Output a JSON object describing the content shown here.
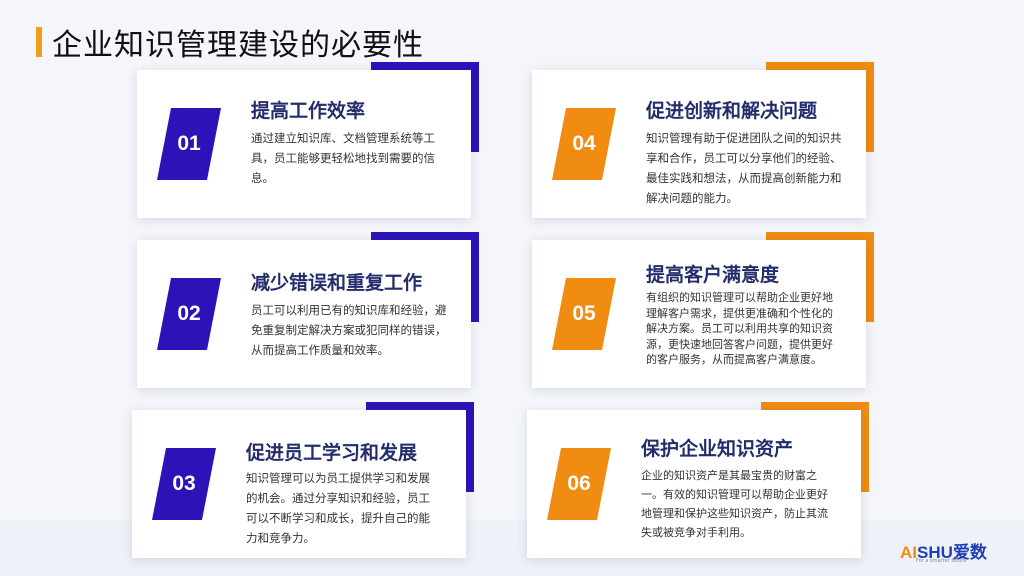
{
  "page": {
    "title": "企业知识管理建设的必要性"
  },
  "cards": [
    {
      "number": "01",
      "title": "提高工作效率",
      "description": "通过建立知识库、文档管理系统等工具，员工能够更轻松地找到需要的信息。",
      "color": "#2b13b8"
    },
    {
      "number": "02",
      "title": "减少错误和重复工作",
      "description": "员工可以利用已有的知识库和经验，避免重复制定解决方案或犯同样的错误，从而提高工作质量和效率。",
      "color": "#2b13b8"
    },
    {
      "number": "03",
      "title": "促进员工学习和发展",
      "description": "知识管理可以为员工提供学习和发展的机会。通过分享知识和经验，员工可以不断学习和成长，提升自己的能力和竞争力。",
      "color": "#2b13b8"
    },
    {
      "number": "04",
      "title": "促进创新和解决问题",
      "description": "知识管理有助于促进团队之间的知识共享和合作，员工可以分享他们的经验、最佳实践和想法，从而提高创新能力和解决问题的能力。",
      "color": "#f08c12"
    },
    {
      "number": "05",
      "title": "提高客户满意度",
      "description": "有组织的知识管理可以帮助企业更好地理解客户需求，提供更准确和个性化的解决方案。员工可以利用共享的知识资源，更快速地回答客户问题，提供更好的客户服务，从而提高客户满意度。",
      "color": "#f08c12"
    },
    {
      "number": "06",
      "title": "保护企业知识资产",
      "description": "企业的知识资产是其最宝贵的财富之一。有效的知识管理可以帮助企业更好地管理和保护这些知识资产，防止其流失或被竞争对手利用。",
      "color": "#f08c12"
    }
  ],
  "logo": {
    "prefix": "AI",
    "suffix": "SHU爱数",
    "tagline": "For a smarter future"
  }
}
